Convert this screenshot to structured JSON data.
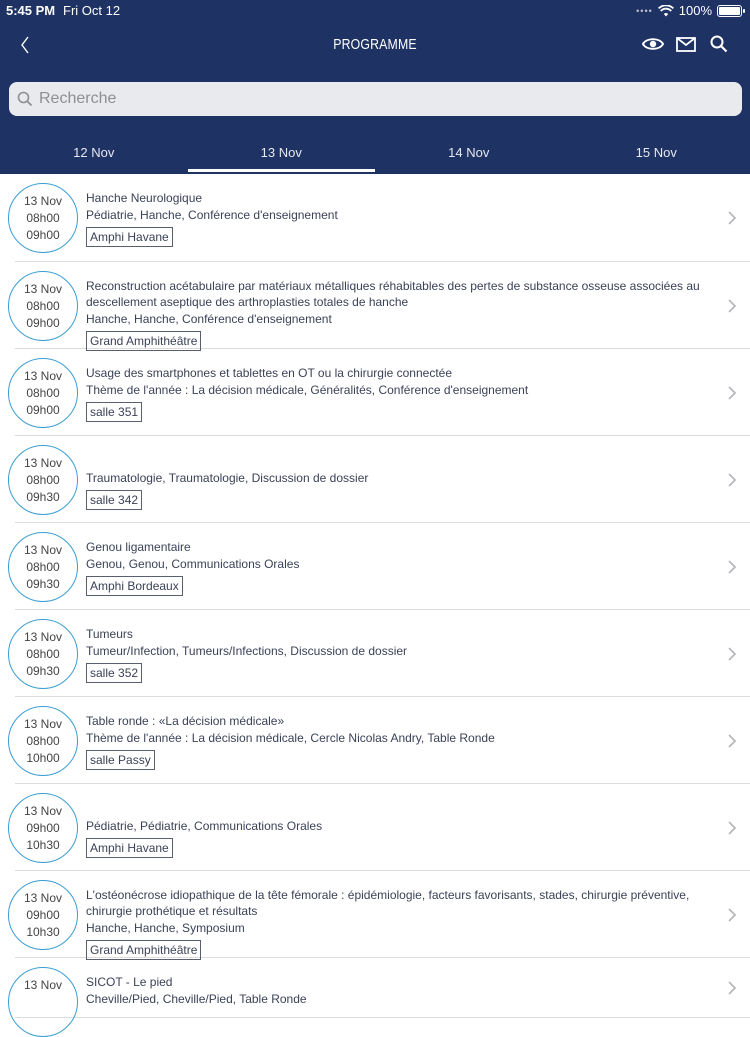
{
  "status_bar": {
    "time": "5:45 PM",
    "date": "Fri Oct 12",
    "battery": "100%"
  },
  "nav": {
    "title": "PROGRAMME"
  },
  "search": {
    "placeholder": "Recherche"
  },
  "tabs": [
    {
      "label": "12 Nov",
      "active": false
    },
    {
      "label": "13 Nov",
      "active": true
    },
    {
      "label": "14 Nov",
      "active": false
    },
    {
      "label": "15 Nov",
      "active": false
    }
  ],
  "sessions": [
    {
      "day": "13 Nov",
      "start": "08h00",
      "end": "09h00",
      "title": "Hanche Neurologique",
      "tags": "Pédiatrie, Hanche, Conférence d'enseignement",
      "room": "Amphi Havane"
    },
    {
      "day": "13 Nov",
      "start": "08h00",
      "end": "09h00",
      "title": "Reconstruction acétabulaire par matériaux métalliques réhabitables des pertes de substance osseuse associées au descellement aseptique des arthroplasties totales de hanche",
      "tags": "Hanche, Hanche, Conférence d'enseignement",
      "room": "Grand Amphithéâtre"
    },
    {
      "day": "13 Nov",
      "start": "08h00",
      "end": "09h00",
      "title": "Usage des smartphones et tablettes en OT ou la chirurgie connectée",
      "tags": "Thème de l'année : La décision médicale, Généralités, Conférence d'enseignement",
      "room": "salle 351"
    },
    {
      "day": "13 Nov",
      "start": "08h00",
      "end": "09h30",
      "title": "",
      "tags": "Traumatologie, Traumatologie, Discussion de dossier",
      "room": "salle 342"
    },
    {
      "day": "13 Nov",
      "start": "08h00",
      "end": "09h30",
      "title": "Genou ligamentaire",
      "tags": "Genou, Genou, Communications Orales",
      "room": "Amphi Bordeaux"
    },
    {
      "day": "13 Nov",
      "start": "08h00",
      "end": "09h30",
      "title": "Tumeurs",
      "tags": "Tumeur/Infection, Tumeurs/Infections, Discussion de dossier",
      "room": "salle 352"
    },
    {
      "day": "13 Nov",
      "start": "08h00",
      "end": "10h00",
      "title": "Table ronde : «La décision médicale»",
      "tags": "Thème de l'année : La décision médicale, Cercle Nicolas Andry, Table Ronde",
      "room": "salle Passy"
    },
    {
      "day": "13 Nov",
      "start": "09h00",
      "end": "10h30",
      "title": "",
      "tags": "Pédiatrie, Pédiatrie, Communications Orales",
      "room": "Amphi Havane"
    },
    {
      "day": "13 Nov",
      "start": "09h00",
      "end": "10h30",
      "title": "L'ostéonécrose idiopathique de la tête fémorale : épidémiologie, facteurs favorisants, stades, chirurgie préventive, chirurgie prothétique et résultats",
      "tags": "Hanche, Hanche, Symposium",
      "room": "Grand Amphithéâtre"
    },
    {
      "day": "13 Nov",
      "start": "",
      "end": "",
      "title": "SICOT - Le pied",
      "tags": "Cheville/Pied, Cheville/Pied, Table Ronde",
      "room": ""
    }
  ]
}
